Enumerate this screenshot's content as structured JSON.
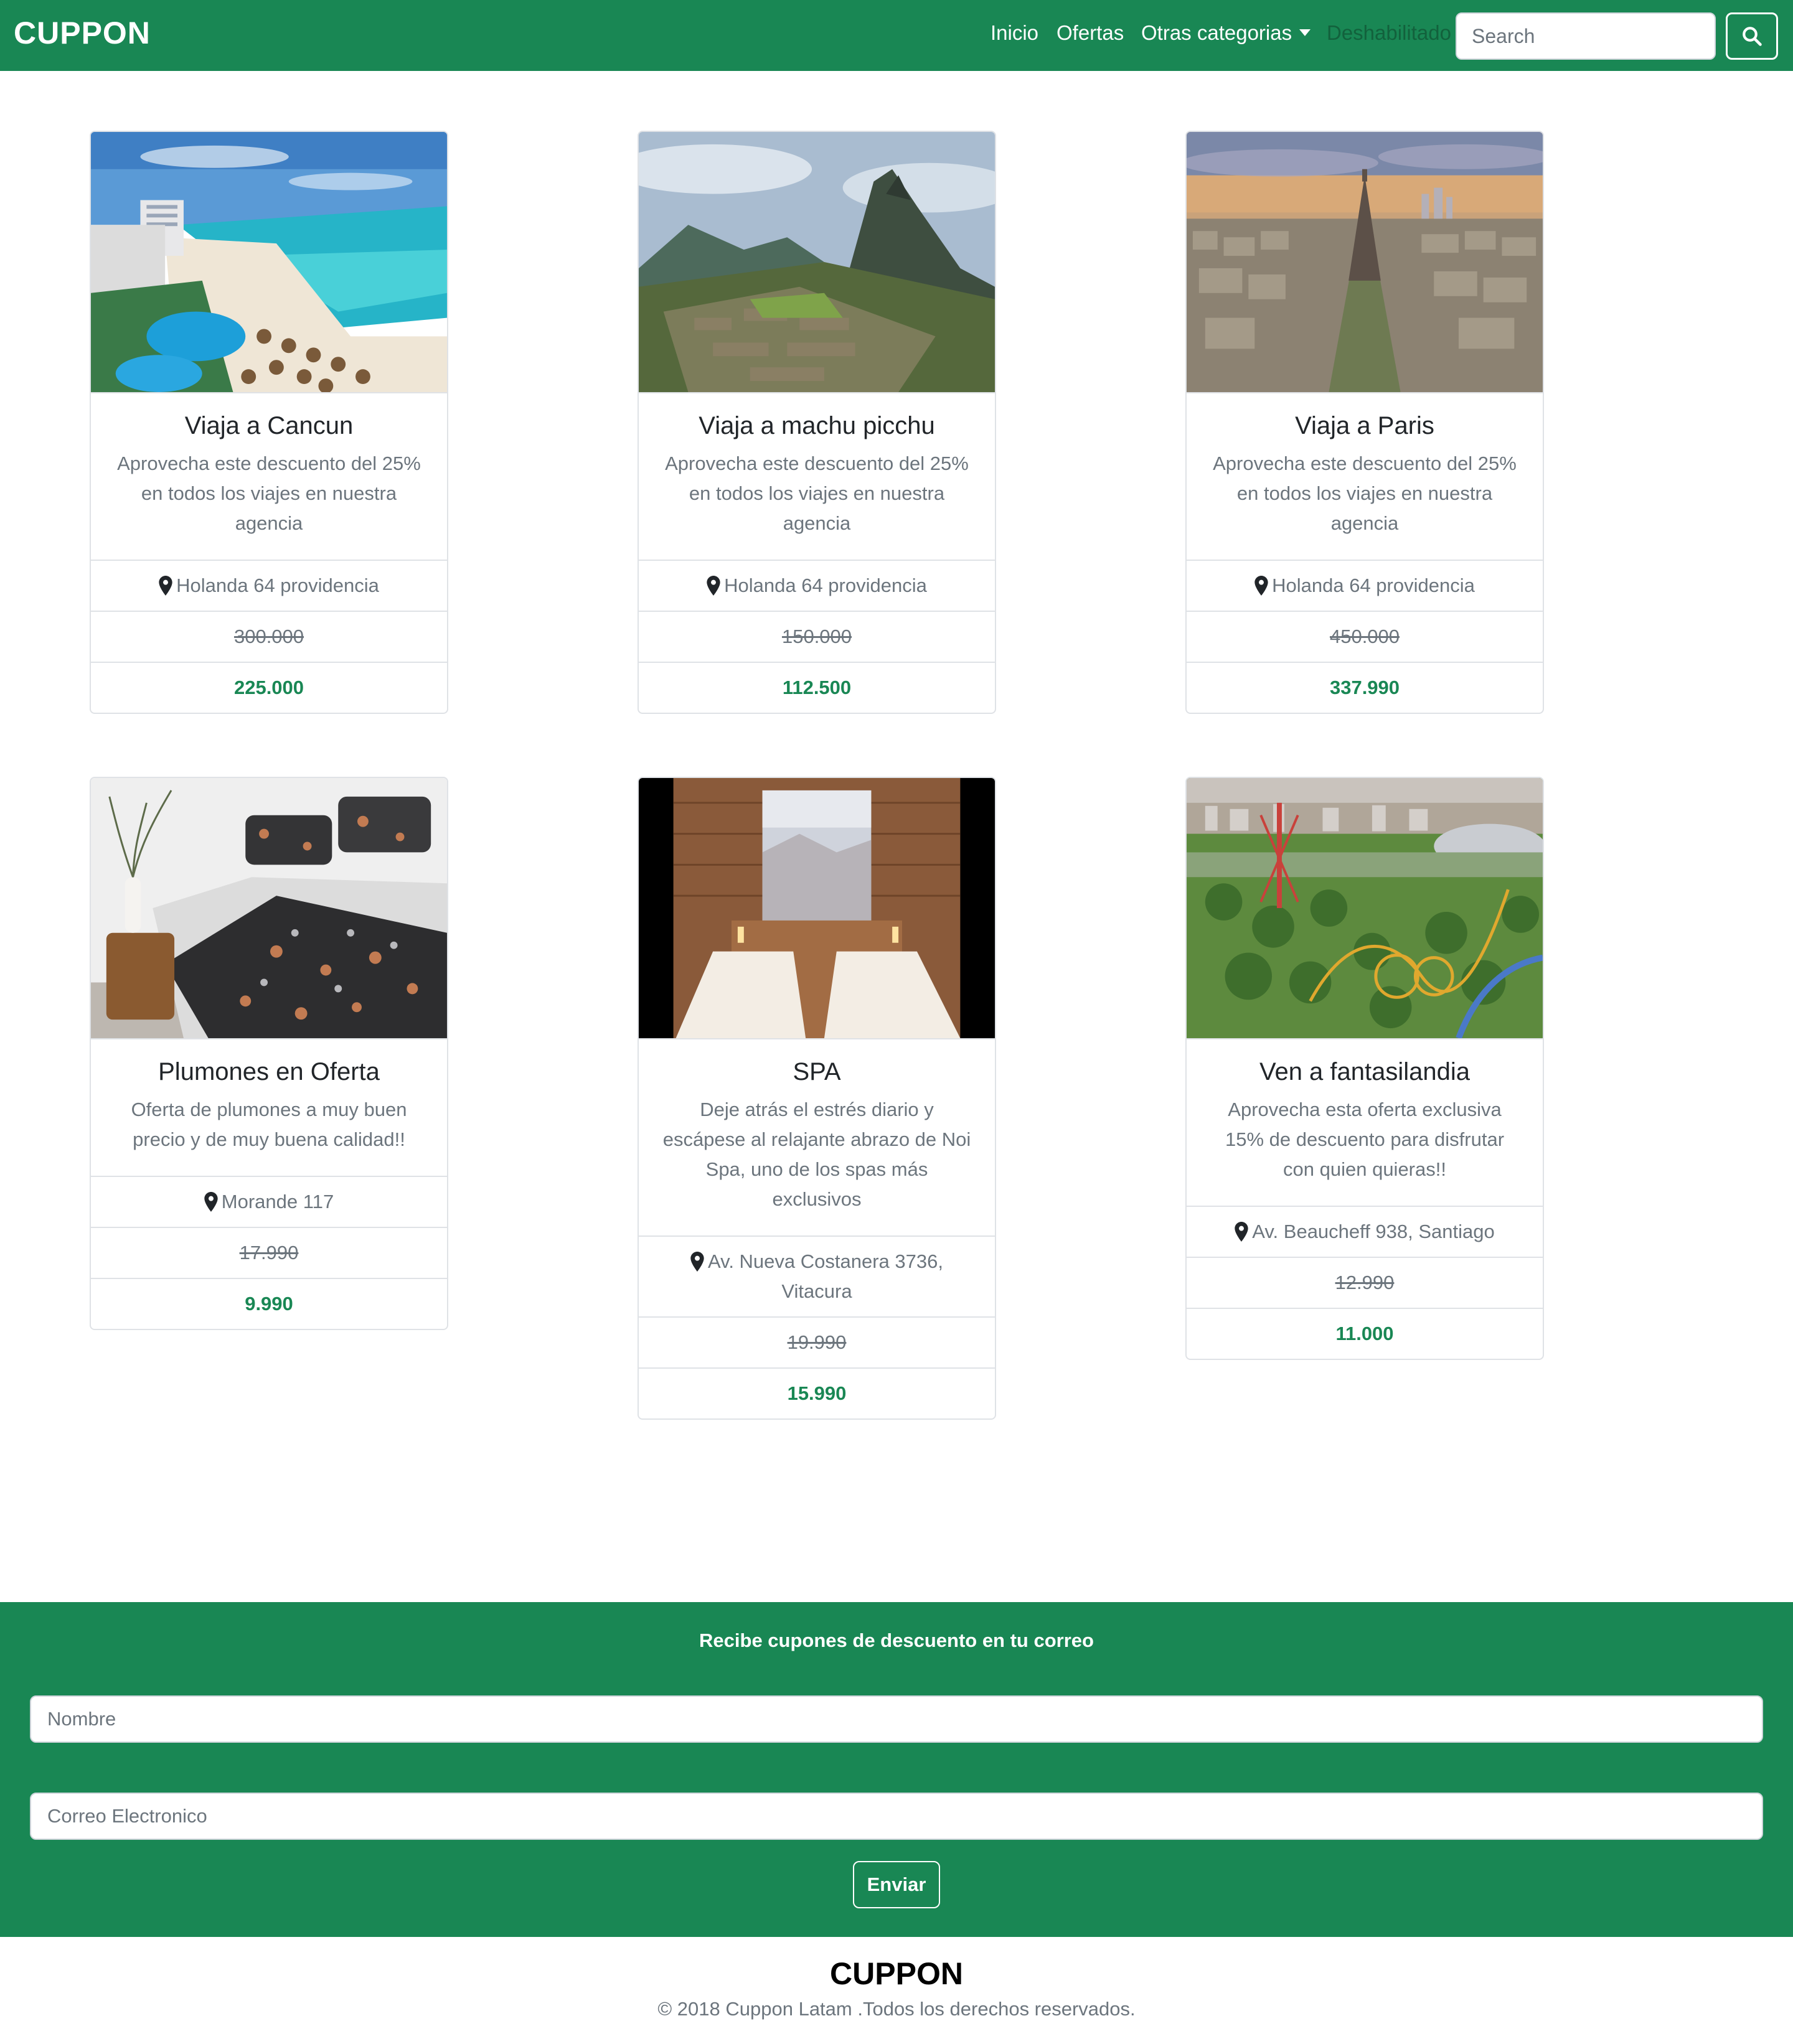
{
  "brand": "CUPPON",
  "nav": {
    "items": [
      "Inicio",
      "Ofertas",
      "Otras categorias",
      "Deshabilitado"
    ],
    "search_placeholder": "Search"
  },
  "cards": [
    {
      "title": "Viaja a Cancun",
      "text": "Aprovecha este descuento del 25% en todos los viajes en nuestra agencia",
      "address": "Holanda 64 providencia",
      "old_price": "300.000",
      "new_price": "225.000",
      "image": "cancun-beach-resort"
    },
    {
      "title": "Viaja a machu picchu",
      "text": "Aprovecha este descuento del 25% en todos los viajes en nuestra agencia",
      "address": "Holanda 64 providencia",
      "old_price": "150.000",
      "new_price": "112.500",
      "image": "machu-picchu-ruins"
    },
    {
      "title": "Viaja a Paris",
      "text": "Aprovecha este descuento del 25% en todos los viajes en nuestra agencia",
      "address": "Holanda 64 providencia",
      "old_price": "450.000",
      "new_price": "337.990",
      "image": "paris-skyline"
    },
    {
      "title": "Plumones en Oferta",
      "text": "Oferta de plumones a muy buen precio y de muy buena calidad!!",
      "address": "Morande 117",
      "old_price": "17.990",
      "new_price": "9.990",
      "image": "bed-comforter"
    },
    {
      "title": "SPA",
      "text": "Deje atrás el estrés diario y escápese al relajante abrazo de Noi Spa, uno de los spas más exclusivos",
      "address": "Av. Nueva Costanera 3736, Vitacura",
      "old_price": "19.990",
      "new_price": "15.990",
      "image": "spa-room"
    },
    {
      "title": "Ven a fantasilandia",
      "text": "Aprovecha esta oferta exclusiva 15% de descuento para disfrutar con quien quieras!!",
      "address": "Av. Beaucheff 938, Santiago",
      "old_price": "12.990",
      "new_price": "11.000",
      "image": "amusement-park"
    }
  ],
  "newsletter": {
    "title": "Recibe cupones de descuento en tu correo",
    "name_placeholder": "Nombre",
    "email_placeholder": "Correo Electronico",
    "submit_label": "Enviar"
  },
  "footer": {
    "brand": "CUPPON",
    "copyright": "© 2018 Cuppon Latam .Todos los derechos reservados."
  },
  "colors": {
    "primary": "#198754",
    "muted": "#6c757d",
    "border": "#dfe2e6"
  }
}
